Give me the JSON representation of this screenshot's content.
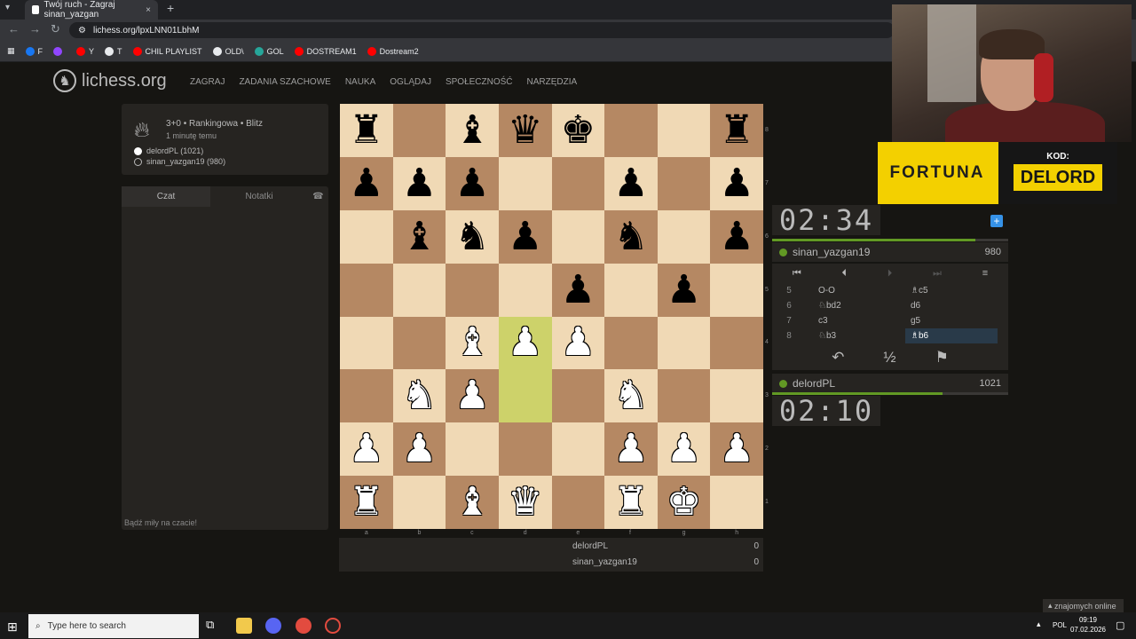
{
  "browser": {
    "tab_title": "Twój ruch - Zagraj sinan_yazgan",
    "tab_close": "×",
    "new_tab": "+",
    "url": "lichess.org/lpxLNN01LbhM",
    "bookmarks": [
      {
        "label": "F",
        "color": "#1877f2"
      },
      {
        "label": "",
        "color": "#9146ff"
      },
      {
        "label": "Y",
        "color": "#ff0000"
      },
      {
        "label": "T",
        "color": "#e8eaed"
      },
      {
        "label": "CHIL PLAYLIST",
        "color": "#ff0000"
      },
      {
        "label": "OLD\\",
        "color": "#e8eaed"
      },
      {
        "label": "GOL",
        "color": "#26a69a"
      },
      {
        "label": "DOSTREAM1",
        "color": "#ff0000"
      },
      {
        "label": "Dostream2",
        "color": "#ff0000"
      }
    ]
  },
  "site": {
    "logo": "lichess.org",
    "nav": [
      "ZAGRAJ",
      "ZADANIA SZACHOWE",
      "NAUKA",
      "OGLĄDAJ",
      "SPOŁECZNOŚĆ",
      "NARZĘDZIA"
    ]
  },
  "game": {
    "title": "3+0 • Rankingowa • Blitz",
    "time_ago": "1 minutę temu",
    "players": [
      "delordPL (1021)",
      "sinan_yazgan19 (980)"
    ]
  },
  "chat": {
    "tab_chat": "Czat",
    "tab_notes": "Notatki",
    "placeholder": "Bądź miły na czacie!"
  },
  "board": {
    "highlight_squares": [
      "d4",
      "d3"
    ],
    "files": [
      "a",
      "b",
      "c",
      "d",
      "e",
      "f",
      "g",
      "h"
    ],
    "ranks": [
      "8",
      "7",
      "6",
      "5",
      "4",
      "3",
      "2",
      "1"
    ],
    "rows": [
      [
        "br",
        "",
        "bb",
        "bq",
        "bk",
        "",
        "",
        "br"
      ],
      [
        "bp",
        "bp",
        "bp",
        "",
        "",
        "bp",
        "",
        "bp"
      ],
      [
        "",
        "bb",
        "bn",
        "bp",
        "",
        "bn",
        "",
        "bp"
      ],
      [
        "",
        "",
        "",
        "",
        "bp",
        "",
        "bp",
        ""
      ],
      [
        "",
        "",
        "wb",
        "wp",
        "wp",
        "",
        "",
        ""
      ],
      [
        "",
        "wn",
        "wp",
        "",
        "",
        "wn",
        "",
        ""
      ],
      [
        "wp",
        "wp",
        "",
        "",
        "",
        "wp",
        "wp",
        "wp"
      ],
      [
        "wr",
        "",
        "wb",
        "wq",
        "",
        "wr",
        "wk",
        ""
      ]
    ]
  },
  "score": [
    {
      "name": "delordPL",
      "value": "0"
    },
    {
      "name": "sinan_yazgan19",
      "value": "0"
    }
  ],
  "opponent": {
    "clock": "02:34",
    "name": "sinan_yazgan19",
    "rating": "980",
    "time_fraction": 0.86
  },
  "player": {
    "clock": "02:10",
    "name": "delordPL",
    "rating": "1021",
    "time_fraction": 0.72
  },
  "moves": [
    {
      "num": "5",
      "white": "O-O",
      "black": "♗c5"
    },
    {
      "num": "6",
      "white": "♘bd2",
      "black": "d6"
    },
    {
      "num": "7",
      "white": "c3",
      "black": "g5"
    },
    {
      "num": "8",
      "white": "♘b3",
      "black": "♗b6",
      "active": true
    }
  ],
  "sponsor": {
    "brand": "FORTUNA",
    "code_label": "KOD:",
    "code": "DELORD"
  },
  "friends": "znajomych online",
  "taskbar": {
    "search_placeholder": "Type here to search",
    "lang": "POL",
    "time": "09:19",
    "date": "07.02.2026"
  }
}
